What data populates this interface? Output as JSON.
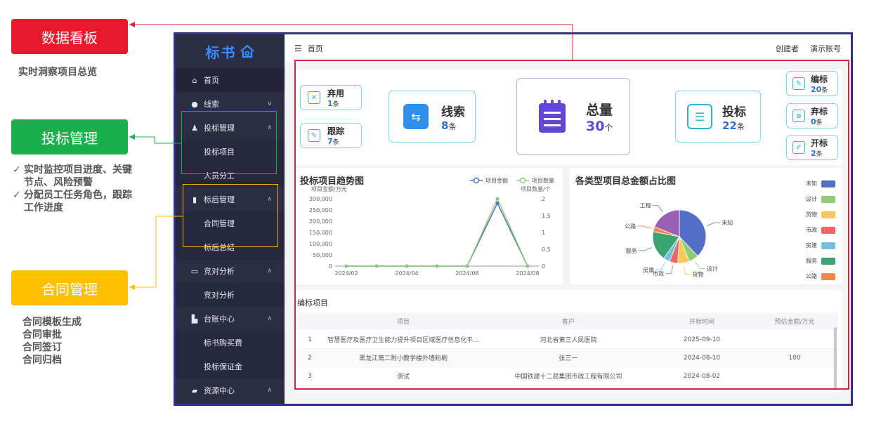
{
  "annotations": {
    "dashboard_label": "数据看板",
    "dashboard_note": "实时洞察项目总览",
    "bid_label": "投标管理",
    "bid_notes": [
      "实时监控项目进度、关键节点、风险预警",
      "分配员工任务角色，跟踪工作进度"
    ],
    "contract_label": "合同管理",
    "contract_notes": [
      "合同模板生成",
      "合同审批",
      "合同签订",
      "合同归档"
    ]
  },
  "app": {
    "logo_text": "标书",
    "breadcrumb": "首页",
    "user_creator": "创建者",
    "user_account": "演示账号"
  },
  "sidebar": {
    "items": [
      {
        "label": "首页",
        "icon": "home-icon",
        "glyph": "⌂"
      },
      {
        "label": "线索",
        "icon": "pin-icon",
        "glyph": "●"
      },
      {
        "label": "投标管理",
        "icon": "user-icon",
        "glyph": "♟"
      },
      {
        "label": "投标项目"
      },
      {
        "label": "人员分工"
      },
      {
        "label": "标后管理",
        "icon": "chart-icon",
        "glyph": "▮"
      },
      {
        "label": "合同管理"
      },
      {
        "label": "标后总结"
      },
      {
        "label": "竞对分析",
        "icon": "monitor-icon",
        "glyph": "▭"
      },
      {
        "label": "竞对分析"
      },
      {
        "label": "台账中心",
        "icon": "stamp-icon",
        "glyph": "▙"
      },
      {
        "label": "标书购买费"
      },
      {
        "label": "投标保证金"
      },
      {
        "label": "资源中心",
        "icon": "lock-icon",
        "glyph": "▰"
      }
    ],
    "chevron_down": "∨",
    "chevron_up": "∧"
  },
  "stats": {
    "abandon": {
      "label": "弃用",
      "value": "1",
      "unit": "条"
    },
    "follow": {
      "label": "跟踪",
      "value": "7",
      "unit": "条"
    },
    "clue": {
      "label": "线索",
      "value": "8",
      "unit": "条"
    },
    "total": {
      "label": "总量",
      "value": "30",
      "unit": "个"
    },
    "bid": {
      "label": "投标",
      "value": "22",
      "unit": "条"
    },
    "edit_bid": {
      "label": "编标",
      "value": "20",
      "unit": "条"
    },
    "abandon_bid": {
      "label": "弃标",
      "value": "0",
      "unit": "条"
    },
    "open_bid": {
      "label": "开标",
      "value": "2",
      "unit": "条"
    }
  },
  "chart_data": [
    {
      "type": "line",
      "title": "投标项目趋势图",
      "x": [
        "2024/02",
        "2024/03",
        "2024/04",
        "2024/05",
        "2024/06",
        "2024/07",
        "2024/08"
      ],
      "xticks": [
        "2024/02",
        "2024/04",
        "2024/06",
        "2024/08"
      ],
      "series": [
        {
          "name": "项目金额",
          "axis": "left",
          "color": "#5470c6",
          "values": [
            0,
            0,
            0,
            0,
            0,
            280000,
            0
          ]
        },
        {
          "name": "项目数量",
          "axis": "right",
          "color": "#91cc75",
          "values": [
            0,
            0,
            0,
            0,
            0,
            2,
            0
          ]
        }
      ],
      "ylabel": "项目金额/万元",
      "ylabel_right": "项目数量/个",
      "ylim": [
        0,
        300000
      ],
      "ylim_right": [
        0,
        2
      ],
      "yticks": [
        "300,000",
        "250,000",
        "200,000",
        "150,000",
        "100,000",
        "50,000",
        "0"
      ],
      "yticks_right": [
        "2",
        "1.5",
        "1",
        "0.5",
        "0"
      ],
      "grid": false,
      "legend": "top-right"
    },
    {
      "type": "pie",
      "title": "各类型项目总金额占比图",
      "slices": [
        {
          "name": "未知",
          "value": 38,
          "color": "#5470c6"
        },
        {
          "name": "设计",
          "value": 6,
          "color": "#91cc75"
        },
        {
          "name": "货物",
          "value": 7,
          "color": "#fac858"
        },
        {
          "name": "市政",
          "value": 5,
          "color": "#ee6666"
        },
        {
          "name": "房建",
          "value": 4,
          "color": "#73c0de"
        },
        {
          "name": "服务",
          "value": 18,
          "color": "#3ba272"
        },
        {
          "name": "公路",
          "value": 3,
          "color": "#fc8452"
        },
        {
          "name": "工程",
          "value": 19,
          "color": "#9a60b4"
        }
      ],
      "legend": "right"
    }
  ],
  "table": {
    "title": "编标项目",
    "headers": [
      "",
      "项目",
      "客户",
      "开标时间",
      "预估金额/万元"
    ],
    "rows": [
      [
        "1",
        "智慧医疗及医疗卫生能力提升项目区域医疗信息化平...",
        "河北省第三人民医院",
        "2025-09-10",
        ""
      ],
      [
        "2",
        "黑龙江第二附小教学楼外墙粉刷",
        "张三一",
        "2024-08-10",
        "100"
      ],
      [
        "3",
        "测试",
        "中国铁建十二局集团市政工程有限公司",
        "2024-08-02",
        ""
      ]
    ]
  }
}
